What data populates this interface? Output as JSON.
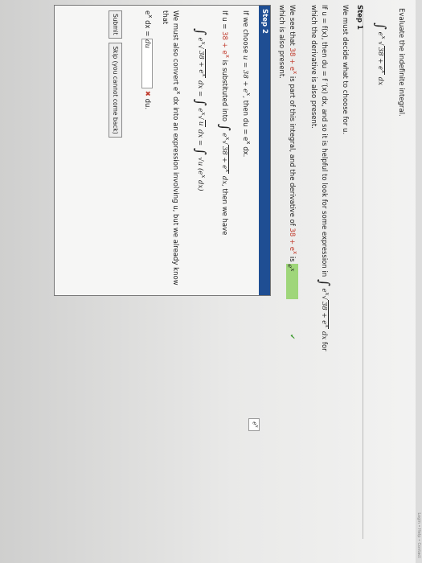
{
  "header": {
    "corner": "Login • Help • Contact"
  },
  "problem": {
    "prompt": "Evaluate the indefinite integral.",
    "integrand_pre": "e",
    "integrand_exp": "x",
    "radicand": "38 + e",
    "radicand_exp": "x",
    "dx": "dx"
  },
  "step1": {
    "title": "Step 1",
    "line1": "We must decide what to choose for u.",
    "line2_a": "If u = f(x), then du = f ′(x) dx, and so it is helpful to look for some expression in",
    "line2_b": "for",
    "line3": "which the derivative is also present.",
    "line4_a": "We see that",
    "line4_red": "38 + e",
    "line4_b": "is part of this integral, and the derivative of",
    "line4_c": "38 + e",
    "line4_d": "is",
    "line5": "which is also present.",
    "answer": "e",
    "answer_exp": "x"
  },
  "step2": {
    "title": "Step 2",
    "line1_a": "If we choose",
    "line1_u": "u = 38 + e",
    "line1_b": "then du = e",
    "line1_c": "dx.",
    "line2_a": "If u =",
    "line2_red": "38 + e",
    "line2_b": "is substituted into",
    "line2_c": "then we have",
    "eq_mid": "dx =",
    "eq_right": "√u (e",
    "eq_tail": "dx)",
    "line3_a": "We must also convert e",
    "line3_b": "dx into an expression involving u, but we already know that",
    "line4_a": "e",
    "line4_b": "dx =",
    "input_value": "du",
    "line4_c": "du.",
    "submit": "Submit",
    "skip": "Skip (you cannot come back)"
  }
}
